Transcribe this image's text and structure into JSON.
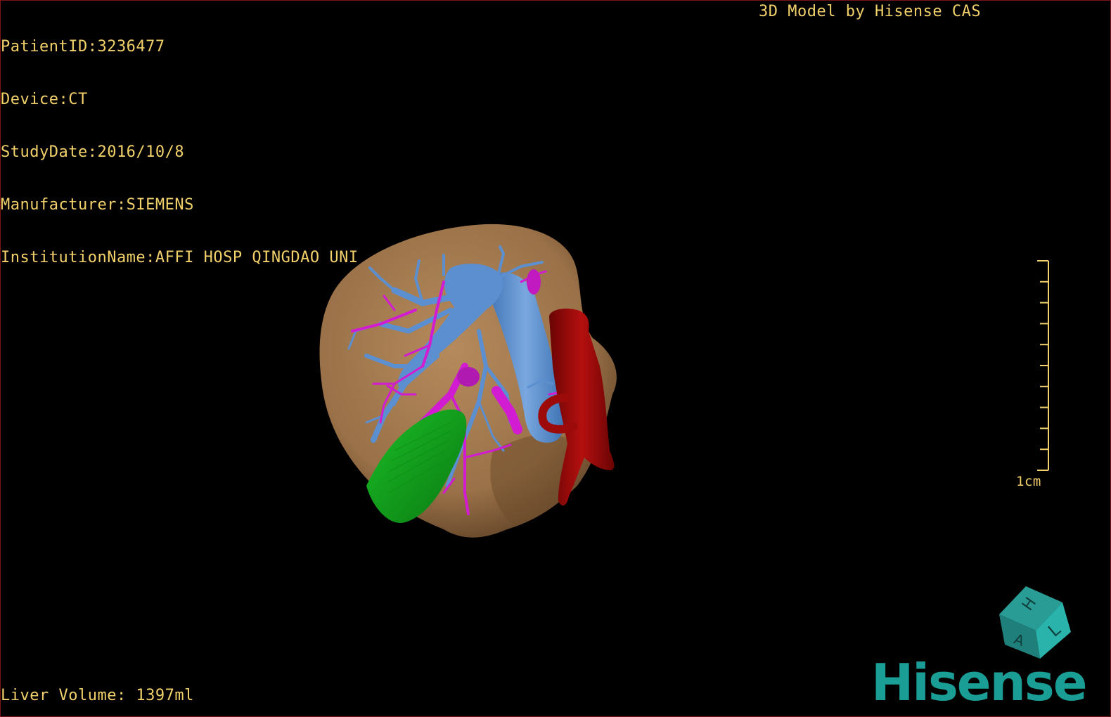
{
  "header": {
    "patient_id": "PatientID:3236477",
    "device": "Device:CT",
    "study_date": "StudyDate:2016/10/8",
    "manufacturer": "Manufacturer:SIEMENS",
    "institution": "InstitutionName:AFFI HOSP QINGDAO UNI",
    "brand_caption": "3D Model by Hisense CAS"
  },
  "footer": {
    "liver_volume": "Liver Volume: 1397ml"
  },
  "scale_bar": {
    "label": "1cm",
    "tick_count": 11
  },
  "orientation_cube": {
    "top_face": "H",
    "right_face": "L",
    "front_face": "A"
  },
  "logo": {
    "text": "Hisense",
    "color": "#1a9d94"
  },
  "colors": {
    "overlay_text": "#f2d16a",
    "liver": "#a27a4f",
    "portal_vein": "#5b8fd0",
    "hepatic_artery": "#d21cd2",
    "aorta": "#9c0a0a",
    "gallbladder": "#0ea21a",
    "border": "#7a1515"
  }
}
